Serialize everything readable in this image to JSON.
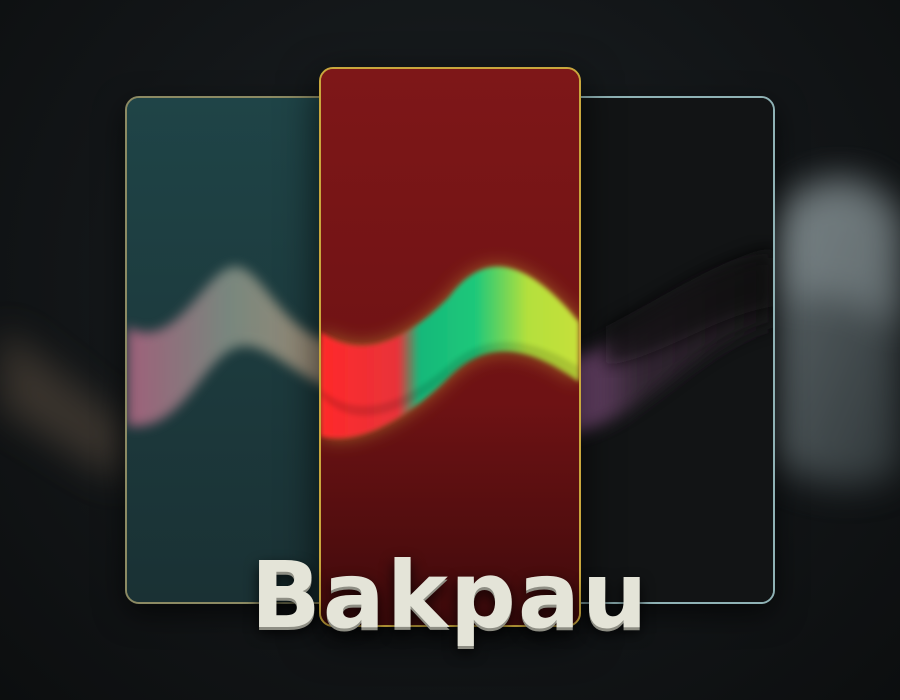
{
  "brand": {
    "title": "Bakpau"
  },
  "colors": {
    "background": "#121517",
    "left_panel": "#1d3b3f",
    "center_panel": "#7a1416",
    "right_panel": "#111314",
    "left_border": "#8c8a63",
    "center_border": "#c9a73d",
    "right_border": "#8fb2b5",
    "title_text": "#e4e4d8"
  },
  "wallpapers": [
    {
      "name": "teal",
      "wave_colors": [
        "#c06a8a",
        "#9a9a8a",
        "#c8a080"
      ]
    },
    {
      "name": "red",
      "wave_colors": [
        "#ff2a2a",
        "#14c47c",
        "#b4e03c"
      ]
    },
    {
      "name": "dark",
      "wave_colors": [
        "#b06ab0",
        "#1a1a1a"
      ]
    }
  ]
}
